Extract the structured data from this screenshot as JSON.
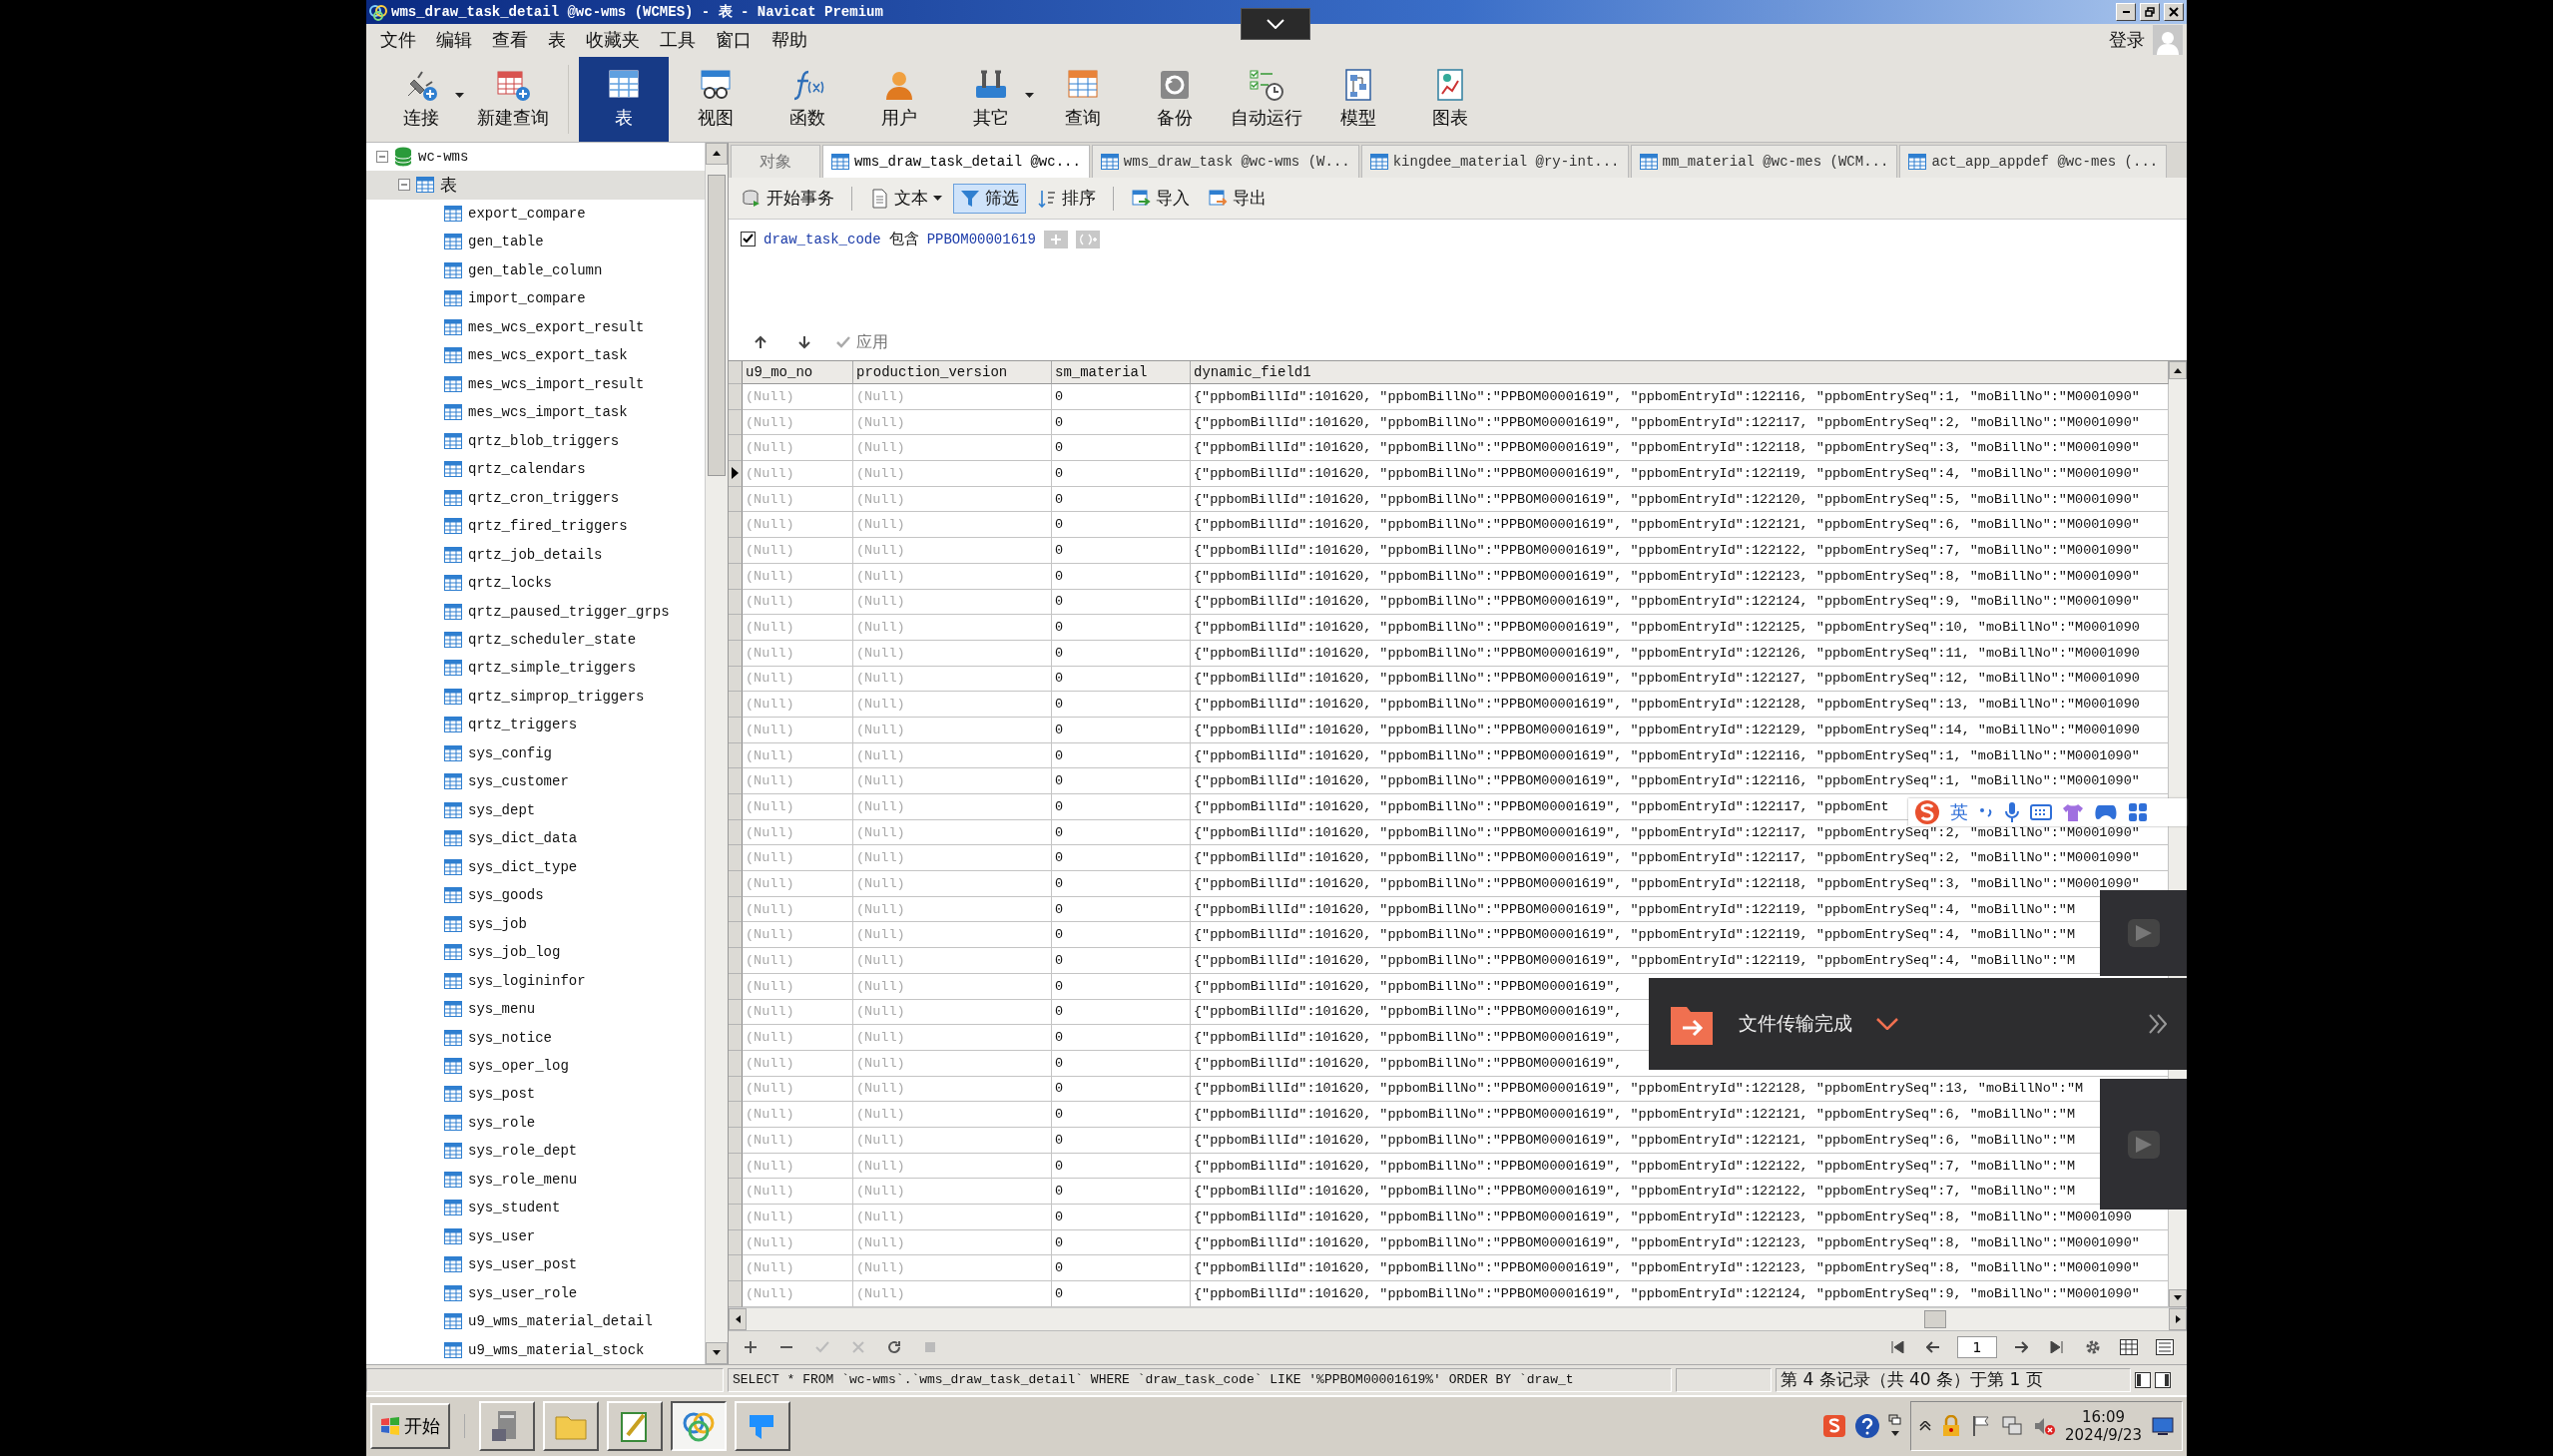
{
  "window": {
    "title": "wms_draw_task_detail @wc-wms (WCMES) - 表 - Navicat Premium"
  },
  "menu": [
    "文件",
    "编辑",
    "查看",
    "表",
    "收藏夹",
    "工具",
    "窗口",
    "帮助"
  ],
  "account": {
    "label": "登录"
  },
  "toolbar": [
    {
      "label": "连接",
      "selected": false,
      "has_menu": true
    },
    {
      "label": "新建查询",
      "selected": false,
      "has_menu": false
    },
    {
      "label": "表",
      "selected": true,
      "has_menu": false
    },
    {
      "label": "视图",
      "selected": false,
      "has_menu": false
    },
    {
      "label": "函数",
      "selected": false,
      "has_menu": false
    },
    {
      "label": "用户",
      "selected": false,
      "has_menu": false
    },
    {
      "label": "其它",
      "selected": false,
      "has_menu": true
    },
    {
      "label": "查询",
      "selected": false,
      "has_menu": false
    },
    {
      "label": "备份",
      "selected": false,
      "has_menu": false
    },
    {
      "label": "自动运行",
      "selected": false,
      "has_menu": false
    },
    {
      "label": "模型",
      "selected": false,
      "has_menu": false
    },
    {
      "label": "图表",
      "selected": false,
      "has_menu": false
    }
  ],
  "tree": {
    "label": "wc-wms",
    "expanded": true,
    "children": [
      {
        "label": "表",
        "expanded": true,
        "selected": true,
        "children": [
          {
            "label": "export_compare",
            "selected": false
          },
          {
            "label": "gen_table",
            "selected": false
          },
          {
            "label": "gen_table_column",
            "selected": false
          },
          {
            "label": "import_compare",
            "selected": false
          },
          {
            "label": "mes_wcs_export_result",
            "selected": false
          },
          {
            "label": "mes_wcs_export_task",
            "selected": false
          },
          {
            "label": "mes_wcs_import_result",
            "selected": false
          },
          {
            "label": "mes_wcs_import_task",
            "selected": false
          },
          {
            "label": "qrtz_blob_triggers",
            "selected": false
          },
          {
            "label": "qrtz_calendars",
            "selected": false
          },
          {
            "label": "qrtz_cron_triggers",
            "selected": false
          },
          {
            "label": "qrtz_fired_triggers",
            "selected": false
          },
          {
            "label": "qrtz_job_details",
            "selected": false
          },
          {
            "label": "qrtz_locks",
            "selected": false
          },
          {
            "label": "qrtz_paused_trigger_grps",
            "selected": false
          },
          {
            "label": "qrtz_scheduler_state",
            "selected": false
          },
          {
            "label": "qrtz_simple_triggers",
            "selected": false
          },
          {
            "label": "qrtz_simprop_triggers",
            "selected": false
          },
          {
            "label": "qrtz_triggers",
            "selected": false
          },
          {
            "label": "sys_config",
            "selected": false
          },
          {
            "label": "sys_customer",
            "selected": false
          },
          {
            "label": "sys_dept",
            "selected": false
          },
          {
            "label": "sys_dict_data",
            "selected": false
          },
          {
            "label": "sys_dict_type",
            "selected": false
          },
          {
            "label": "sys_goods",
            "selected": false
          },
          {
            "label": "sys_job",
            "selected": false
          },
          {
            "label": "sys_job_log",
            "selected": false
          },
          {
            "label": "sys_logininfor",
            "selected": false
          },
          {
            "label": "sys_menu",
            "selected": false
          },
          {
            "label": "sys_notice",
            "selected": false
          },
          {
            "label": "sys_oper_log",
            "selected": false
          },
          {
            "label": "sys_post",
            "selected": false
          },
          {
            "label": "sys_role",
            "selected": false
          },
          {
            "label": "sys_role_dept",
            "selected": false
          },
          {
            "label": "sys_role_menu",
            "selected": false
          },
          {
            "label": "sys_student",
            "selected": false
          },
          {
            "label": "sys_user",
            "selected": false
          },
          {
            "label": "sys_user_post",
            "selected": false
          },
          {
            "label": "sys_user_role",
            "selected": false
          },
          {
            "label": "u9_wms_material_detail",
            "selected": false
          },
          {
            "label": "u9_wms_material_stock",
            "selected": false
          }
        ]
      }
    ]
  },
  "tabs": [
    {
      "label": "对象",
      "selected": false
    },
    {
      "label": "wms_draw_task_detail @wc...",
      "selected": true
    },
    {
      "label": "wms_draw_task @wc-wms (W...",
      "selected": false
    },
    {
      "label": "kingdee_material @ry-int...",
      "selected": false
    },
    {
      "label": "mm_material @wc-mes (WCM...",
      "selected": false
    },
    {
      "label": "act_app_appdef @wc-mes (...",
      "selected": false
    }
  ],
  "object_toolbar": [
    {
      "label": "开始事务",
      "selected": false,
      "has_menu": false
    },
    {
      "label": "文本",
      "selected": false,
      "has_menu": true
    },
    {
      "label": "筛选",
      "selected": true,
      "has_menu": false
    },
    {
      "label": "排序",
      "selected": false,
      "has_menu": false
    },
    {
      "label": "导入",
      "selected": false,
      "has_menu": false
    },
    {
      "label": "导出",
      "selected": false,
      "has_menu": false
    }
  ],
  "filter": {
    "checked": true,
    "field": "draw_task_code",
    "operator": "包含",
    "value": "PPBOM00001619",
    "apply": "应用"
  },
  "grid": {
    "columns": [
      "u9_mo_no",
      "production_version",
      "sm_material",
      "dynamic_field1"
    ],
    "rows": [
      {
        "current": false,
        "cells": [
          {
            "text": "(Null)",
            "null": true
          },
          {
            "text": "(Null)",
            "null": true
          },
          {
            "text": "0",
            "null": false
          },
          {
            "text": "{\"ppbomBillId\":101620, \"ppbomBillNo\":\"PPBOM00001619\", \"ppbomEntryId\":122116, \"ppbomEntrySeq\":1, \"moBillNo\":\"M0001090\"",
            "null": false
          }
        ]
      },
      {
        "current": false,
        "cells": [
          {
            "text": "(Null)",
            "null": true
          },
          {
            "text": "(Null)",
            "null": true
          },
          {
            "text": "0",
            "null": false
          },
          {
            "text": "{\"ppbomBillId\":101620, \"ppbomBillNo\":\"PPBOM00001619\", \"ppbomEntryId\":122117, \"ppbomEntrySeq\":2, \"moBillNo\":\"M0001090\"",
            "null": false
          }
        ]
      },
      {
        "current": false,
        "cells": [
          {
            "text": "(Null)",
            "null": true
          },
          {
            "text": "(Null)",
            "null": true
          },
          {
            "text": "0",
            "null": false
          },
          {
            "text": "{\"ppbomBillId\":101620, \"ppbomBillNo\":\"PPBOM00001619\", \"ppbomEntryId\":122118, \"ppbomEntrySeq\":3, \"moBillNo\":\"M0001090\"",
            "null": false
          }
        ]
      },
      {
        "current": true,
        "cells": [
          {
            "text": "(Null)",
            "null": true
          },
          {
            "text": "(Null)",
            "null": true
          },
          {
            "text": "0",
            "null": false
          },
          {
            "text": "{\"ppbomBillId\":101620, \"ppbomBillNo\":\"PPBOM00001619\", \"ppbomEntryId\":122119, \"ppbomEntrySeq\":4, \"moBillNo\":\"M0001090\"",
            "null": false
          }
        ]
      },
      {
        "current": false,
        "cells": [
          {
            "text": "(Null)",
            "null": true
          },
          {
            "text": "(Null)",
            "null": true
          },
          {
            "text": "0",
            "null": false
          },
          {
            "text": "{\"ppbomBillId\":101620, \"ppbomBillNo\":\"PPBOM00001619\", \"ppbomEntryId\":122120, \"ppbomEntrySeq\":5, \"moBillNo\":\"M0001090\"",
            "null": false
          }
        ]
      },
      {
        "current": false,
        "cells": [
          {
            "text": "(Null)",
            "null": true
          },
          {
            "text": "(Null)",
            "null": true
          },
          {
            "text": "0",
            "null": false
          },
          {
            "text": "{\"ppbomBillId\":101620, \"ppbomBillNo\":\"PPBOM00001619\", \"ppbomEntryId\":122121, \"ppbomEntrySeq\":6, \"moBillNo\":\"M0001090\"",
            "null": false
          }
        ]
      },
      {
        "current": false,
        "cells": [
          {
            "text": "(Null)",
            "null": true
          },
          {
            "text": "(Null)",
            "null": true
          },
          {
            "text": "0",
            "null": false
          },
          {
            "text": "{\"ppbomBillId\":101620, \"ppbomBillNo\":\"PPBOM00001619\", \"ppbomEntryId\":122122, \"ppbomEntrySeq\":7, \"moBillNo\":\"M0001090\"",
            "null": false
          }
        ]
      },
      {
        "current": false,
        "cells": [
          {
            "text": "(Null)",
            "null": true
          },
          {
            "text": "(Null)",
            "null": true
          },
          {
            "text": "0",
            "null": false
          },
          {
            "text": "{\"ppbomBillId\":101620, \"ppbomBillNo\":\"PPBOM00001619\", \"ppbomEntryId\":122123, \"ppbomEntrySeq\":8, \"moBillNo\":\"M0001090\"",
            "null": false
          }
        ]
      },
      {
        "current": false,
        "cells": [
          {
            "text": "(Null)",
            "null": true
          },
          {
            "text": "(Null)",
            "null": true
          },
          {
            "text": "0",
            "null": false
          },
          {
            "text": "{\"ppbomBillId\":101620, \"ppbomBillNo\":\"PPBOM00001619\", \"ppbomEntryId\":122124, \"ppbomEntrySeq\":9, \"moBillNo\":\"M0001090\"",
            "null": false
          }
        ]
      },
      {
        "current": false,
        "cells": [
          {
            "text": "(Null)",
            "null": true
          },
          {
            "text": "(Null)",
            "null": true
          },
          {
            "text": "0",
            "null": false
          },
          {
            "text": "{\"ppbomBillId\":101620, \"ppbomBillNo\":\"PPBOM00001619\", \"ppbomEntryId\":122125, \"ppbomEntrySeq\":10, \"moBillNo\":\"M0001090",
            "null": false
          }
        ]
      },
      {
        "current": false,
        "cells": [
          {
            "text": "(Null)",
            "null": true
          },
          {
            "text": "(Null)",
            "null": true
          },
          {
            "text": "0",
            "null": false
          },
          {
            "text": "{\"ppbomBillId\":101620, \"ppbomBillNo\":\"PPBOM00001619\", \"ppbomEntryId\":122126, \"ppbomEntrySeq\":11, \"moBillNo\":\"M0001090",
            "null": false
          }
        ]
      },
      {
        "current": false,
        "cells": [
          {
            "text": "(Null)",
            "null": true
          },
          {
            "text": "(Null)",
            "null": true
          },
          {
            "text": "0",
            "null": false
          },
          {
            "text": "{\"ppbomBillId\":101620, \"ppbomBillNo\":\"PPBOM00001619\", \"ppbomEntryId\":122127, \"ppbomEntrySeq\":12, \"moBillNo\":\"M0001090",
            "null": false
          }
        ]
      },
      {
        "current": false,
        "cells": [
          {
            "text": "(Null)",
            "null": true
          },
          {
            "text": "(Null)",
            "null": true
          },
          {
            "text": "0",
            "null": false
          },
          {
            "text": "{\"ppbomBillId\":101620, \"ppbomBillNo\":\"PPBOM00001619\", \"ppbomEntryId\":122128, \"ppbomEntrySeq\":13, \"moBillNo\":\"M0001090",
            "null": false
          }
        ]
      },
      {
        "current": false,
        "cells": [
          {
            "text": "(Null)",
            "null": true
          },
          {
            "text": "(Null)",
            "null": true
          },
          {
            "text": "0",
            "null": false
          },
          {
            "text": "{\"ppbomBillId\":101620, \"ppbomBillNo\":\"PPBOM00001619\", \"ppbomEntryId\":122129, \"ppbomEntrySeq\":14, \"moBillNo\":\"M0001090",
            "null": false
          }
        ]
      },
      {
        "current": false,
        "cells": [
          {
            "text": "(Null)",
            "null": true
          },
          {
            "text": "(Null)",
            "null": true
          },
          {
            "text": "0",
            "null": false
          },
          {
            "text": "{\"ppbomBillId\":101620, \"ppbomBillNo\":\"PPBOM00001619\", \"ppbomEntryId\":122116, \"ppbomEntrySeq\":1, \"moBillNo\":\"M0001090\"",
            "null": false
          }
        ]
      },
      {
        "current": false,
        "cells": [
          {
            "text": "(Null)",
            "null": true
          },
          {
            "text": "(Null)",
            "null": true
          },
          {
            "text": "0",
            "null": false
          },
          {
            "text": "{\"ppbomBillId\":101620, \"ppbomBillNo\":\"PPBOM00001619\", \"ppbomEntryId\":122116, \"ppbomEntrySeq\":1, \"moBillNo\":\"M0001090\"",
            "null": false
          }
        ]
      },
      {
        "current": false,
        "cells": [
          {
            "text": "(Null)",
            "null": true
          },
          {
            "text": "(Null)",
            "null": true
          },
          {
            "text": "0",
            "null": false
          },
          {
            "text": "{\"ppbomBillId\":101620, \"ppbomBillNo\":\"PPBOM00001619\", \"ppbomEntryId\":122117, \"ppbomEnt",
            "null": false
          }
        ]
      },
      {
        "current": false,
        "cells": [
          {
            "text": "(Null)",
            "null": true
          },
          {
            "text": "(Null)",
            "null": true
          },
          {
            "text": "0",
            "null": false
          },
          {
            "text": "{\"ppbomBillId\":101620, \"ppbomBillNo\":\"PPBOM00001619\", \"ppbomEntryId\":122117, \"ppbomEntrySeq\":2, \"moBillNo\":\"M0001090\"",
            "null": false
          }
        ]
      },
      {
        "current": false,
        "cells": [
          {
            "text": "(Null)",
            "null": true
          },
          {
            "text": "(Null)",
            "null": true
          },
          {
            "text": "0",
            "null": false
          },
          {
            "text": "{\"ppbomBillId\":101620, \"ppbomBillNo\":\"PPBOM00001619\", \"ppbomEntryId\":122117, \"ppbomEntrySeq\":2, \"moBillNo\":\"M0001090\"",
            "null": false
          }
        ]
      },
      {
        "current": false,
        "cells": [
          {
            "text": "(Null)",
            "null": true
          },
          {
            "text": "(Null)",
            "null": true
          },
          {
            "text": "0",
            "null": false
          },
          {
            "text": "{\"ppbomBillId\":101620, \"ppbomBillNo\":\"PPBOM00001619\", \"ppbomEntryId\":122118, \"ppbomEntrySeq\":3, \"moBillNo\":\"M0001090\"",
            "null": false
          }
        ]
      },
      {
        "current": false,
        "cells": [
          {
            "text": "(Null)",
            "null": true
          },
          {
            "text": "(Null)",
            "null": true
          },
          {
            "text": "0",
            "null": false
          },
          {
            "text": "{\"ppbomBillId\":101620, \"ppbomBillNo\":\"PPBOM00001619\", \"ppbomEntryId\":122119, \"ppbomEntrySeq\":4, \"moBillNo\":\"M",
            "null": false
          }
        ]
      },
      {
        "current": false,
        "cells": [
          {
            "text": "(Null)",
            "null": true
          },
          {
            "text": "(Null)",
            "null": true
          },
          {
            "text": "0",
            "null": false
          },
          {
            "text": "{\"ppbomBillId\":101620, \"ppbomBillNo\":\"PPBOM00001619\", \"ppbomEntryId\":122119, \"ppbomEntrySeq\":4, \"moBillNo\":\"M",
            "null": false
          }
        ]
      },
      {
        "current": false,
        "cells": [
          {
            "text": "(Null)",
            "null": true
          },
          {
            "text": "(Null)",
            "null": true
          },
          {
            "text": "0",
            "null": false
          },
          {
            "text": "{\"ppbomBillId\":101620, \"ppbomBillNo\":\"PPBOM00001619\", \"ppbomEntryId\":122119, \"ppbomEntrySeq\":4, \"moBillNo\":\"M",
            "null": false
          }
        ]
      },
      {
        "current": false,
        "cells": [
          {
            "text": "(Null)",
            "null": true
          },
          {
            "text": "(Null)",
            "null": true
          },
          {
            "text": "0",
            "null": false
          },
          {
            "text": "{\"ppbomBillId\":101620, \"ppbomBillNo\":\"PPBOM00001619\",",
            "null": false
          }
        ]
      },
      {
        "current": false,
        "cells": [
          {
            "text": "(Null)",
            "null": true
          },
          {
            "text": "(Null)",
            "null": true
          },
          {
            "text": "0",
            "null": false
          },
          {
            "text": "{\"ppbomBillId\":101620, \"ppbomBillNo\":\"PPBOM00001619\",",
            "null": false
          }
        ]
      },
      {
        "current": false,
        "cells": [
          {
            "text": "(Null)",
            "null": true
          },
          {
            "text": "(Null)",
            "null": true
          },
          {
            "text": "0",
            "null": false
          },
          {
            "text": "{\"ppbomBillId\":101620, \"ppbomBillNo\":\"PPBOM00001619\",",
            "null": false
          }
        ]
      },
      {
        "current": false,
        "cells": [
          {
            "text": "(Null)",
            "null": true
          },
          {
            "text": "(Null)",
            "null": true
          },
          {
            "text": "0",
            "null": false
          },
          {
            "text": "{\"ppbomBillId\":101620, \"ppbomBillNo\":\"PPBOM00001619\",",
            "null": false
          }
        ]
      },
      {
        "current": false,
        "cells": [
          {
            "text": "(Null)",
            "null": true
          },
          {
            "text": "(Null)",
            "null": true
          },
          {
            "text": "0",
            "null": false
          },
          {
            "text": "{\"ppbomBillId\":101620, \"ppbomBillNo\":\"PPBOM00001619\", \"ppbomEntryId\":122128, \"ppbomEntrySeq\":13, \"moBillNo\":\"M",
            "null": false
          }
        ]
      },
      {
        "current": false,
        "cells": [
          {
            "text": "(Null)",
            "null": true
          },
          {
            "text": "(Null)",
            "null": true
          },
          {
            "text": "0",
            "null": false
          },
          {
            "text": "{\"ppbomBillId\":101620, \"ppbomBillNo\":\"PPBOM00001619\", \"ppbomEntryId\":122121, \"ppbomEntrySeq\":6, \"moBillNo\":\"M",
            "null": false
          }
        ]
      },
      {
        "current": false,
        "cells": [
          {
            "text": "(Null)",
            "null": true
          },
          {
            "text": "(Null)",
            "null": true
          },
          {
            "text": "0",
            "null": false
          },
          {
            "text": "{\"ppbomBillId\":101620, \"ppbomBillNo\":\"PPBOM00001619\", \"ppbomEntryId\":122121, \"ppbomEntrySeq\":6, \"moBillNo\":\"M",
            "null": false
          }
        ]
      },
      {
        "current": false,
        "cells": [
          {
            "text": "(Null)",
            "null": true
          },
          {
            "text": "(Null)",
            "null": true
          },
          {
            "text": "0",
            "null": false
          },
          {
            "text": "{\"ppbomBillId\":101620, \"ppbomBillNo\":\"PPBOM00001619\", \"ppbomEntryId\":122122, \"ppbomEntrySeq\":7, \"moBillNo\":\"M",
            "null": false
          }
        ]
      },
      {
        "current": false,
        "cells": [
          {
            "text": "(Null)",
            "null": true
          },
          {
            "text": "(Null)",
            "null": true
          },
          {
            "text": "0",
            "null": false
          },
          {
            "text": "{\"ppbomBillId\":101620, \"ppbomBillNo\":\"PPBOM00001619\", \"ppbomEntryId\":122122, \"ppbomEntrySeq\":7, \"moBillNo\":\"M",
            "null": false
          }
        ]
      },
      {
        "current": false,
        "cells": [
          {
            "text": "(Null)",
            "null": true
          },
          {
            "text": "(Null)",
            "null": true
          },
          {
            "text": "0",
            "null": false
          },
          {
            "text": "{\"ppbomBillId\":101620, \"ppbomBillNo\":\"PPBOM00001619\", \"ppbomEntryId\":122123, \"ppbomEntrySeq\":8, \"moBillNo\":\"M0001090",
            "null": false
          }
        ]
      },
      {
        "current": false,
        "cells": [
          {
            "text": "(Null)",
            "null": true
          },
          {
            "text": "(Null)",
            "null": true
          },
          {
            "text": "0",
            "null": false
          },
          {
            "text": "{\"ppbomBillId\":101620, \"ppbomBillNo\":\"PPBOM00001619\", \"ppbomEntryId\":122123, \"ppbomEntrySeq\":8, \"moBillNo\":\"M0001090\"",
            "null": false
          }
        ]
      },
      {
        "current": false,
        "cells": [
          {
            "text": "(Null)",
            "null": true
          },
          {
            "text": "(Null)",
            "null": true
          },
          {
            "text": "0",
            "null": false
          },
          {
            "text": "{\"ppbomBillId\":101620, \"ppbomBillNo\":\"PPBOM00001619\", \"ppbomEntryId\":122123, \"ppbomEntrySeq\":8, \"moBillNo\":\"M0001090\"",
            "null": false
          }
        ]
      },
      {
        "current": false,
        "cells": [
          {
            "text": "(Null)",
            "null": true
          },
          {
            "text": "(Null)",
            "null": true
          },
          {
            "text": "0",
            "null": false
          },
          {
            "text": "{\"ppbomBillId\":101620, \"ppbomBillNo\":\"PPBOM00001619\", \"ppbomEntryId\":122124, \"ppbomEntrySeq\":9, \"moBillNo\":\"M0001090\"",
            "null": false
          }
        ]
      }
    ]
  },
  "pager": {
    "page": "1"
  },
  "status_bar": {
    "sql": "SELECT * FROM `wc-wms`.`wms_draw_task_detail` WHERE `draw_task_code` LIKE '%PPBOM00001619%' ORDER BY `draw_t",
    "record_info": "第 4 条记录（共 40 条）于第 1 页"
  },
  "notification": {
    "text": "文件传输完成"
  },
  "ime_bar": {
    "label": "英"
  },
  "taskbar": {
    "start": "开始",
    "time": "16:09",
    "date": "2024/9/23"
  }
}
